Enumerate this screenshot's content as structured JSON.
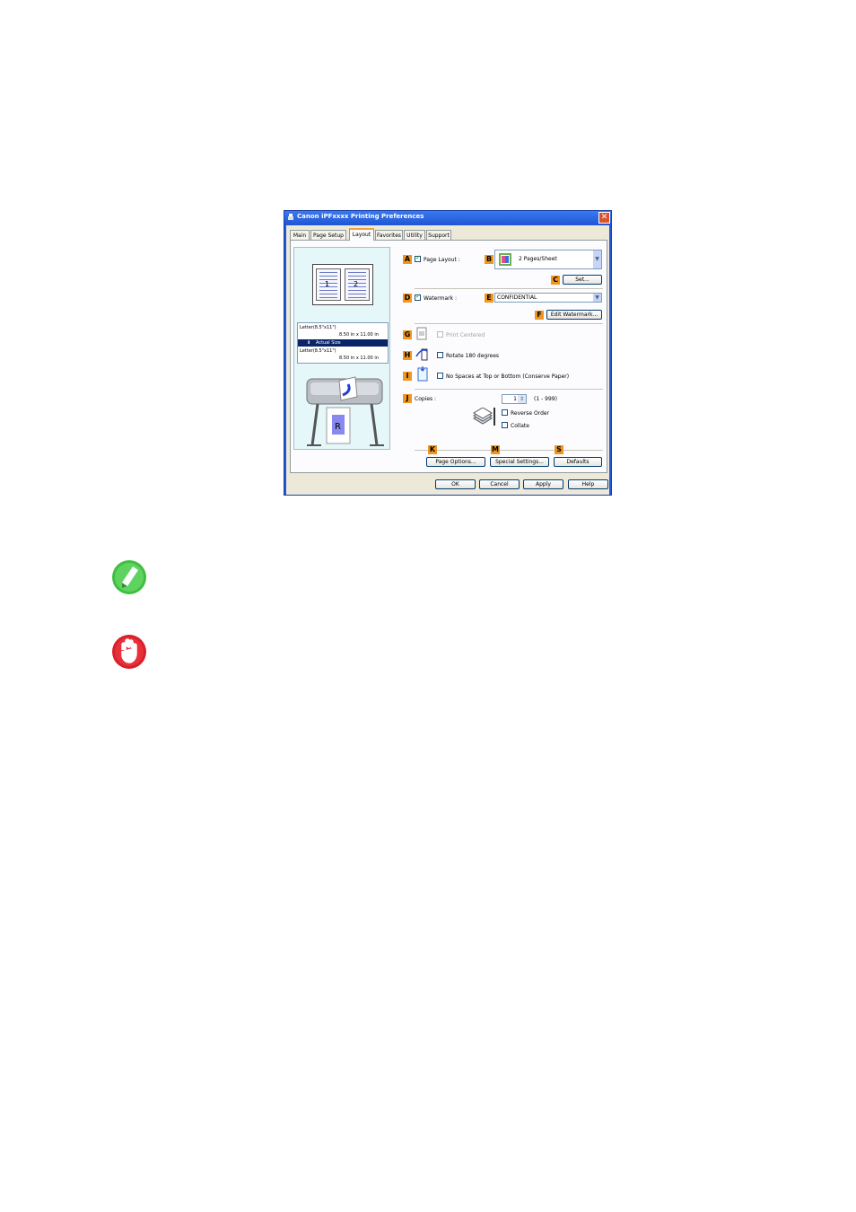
{
  "dialog": {
    "title": "Canon iPFxxxx Printing Preferences",
    "close_glyph": "✕",
    "tabs": [
      "Main",
      "Page Setup",
      "Layout",
      "Favorites",
      "Utility",
      "Support"
    ],
    "active_tab": "Layout"
  },
  "preview": {
    "page_numbers": [
      "1",
      "2"
    ],
    "source_size": "Letter(8.5\"x11\")",
    "source_dims": "8.50 in x 11.00 in",
    "scaling": "Actual Size",
    "output_size": "Letter(8.5\"x11\")",
    "output_dims": "8.50 in x 11.00 in"
  },
  "badges": {
    "A": "A",
    "B": "B",
    "C": "C",
    "D": "D",
    "E": "E",
    "F": "F",
    "G": "G",
    "H": "H",
    "I": "I",
    "J": "J",
    "K": "K",
    "M": "M",
    "S": "S"
  },
  "controls": {
    "page_layout_label": "Page Layout :",
    "page_layout_value": "2 Pages/Sheet",
    "set_button": "Set...",
    "watermark_label": "Watermark :",
    "watermark_value": "CONFIDENTIAL",
    "edit_watermark_button": "Edit Watermark...",
    "print_centered_label": "Print Centered",
    "rotate_label": "Rotate 180 degrees",
    "no_spaces_label": "No Spaces at Top or Bottom (Conserve Paper)",
    "copies_label": "Copies :",
    "copies_value": "1",
    "copies_range": "(1 - 999)",
    "reverse_order_label": "Reverse Order",
    "collate_label": "Collate",
    "page_options_button": "Page Options...",
    "special_settings_button": "Special Settings...",
    "defaults_button": "Defaults"
  },
  "footer": {
    "ok": "OK",
    "cancel": "Cancel",
    "apply": "Apply",
    "help": "Help"
  },
  "colors": {
    "titlebar": "#1f54d4",
    "badge": "#f0961e",
    "note_green": "#3fbf3f",
    "important_red": "#d9202a"
  }
}
